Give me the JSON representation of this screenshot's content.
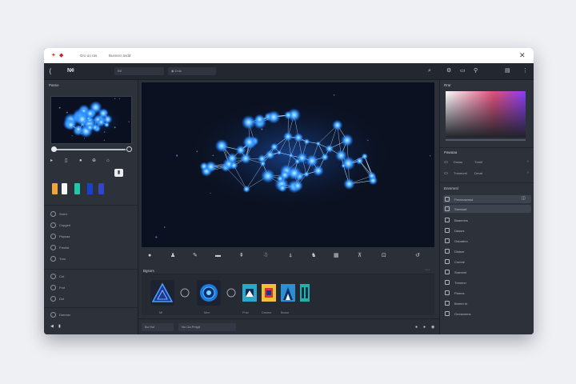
{
  "titlebar": {
    "logo_glyph": "✦",
    "logo_glyph_2": "◆",
    "title_left": "Gro oo ras",
    "title_right": "Busnxsr avdd",
    "close_label": "✕"
  },
  "toolbar": {
    "back_glyph": "⟨",
    "app_name": "N¢",
    "field_1": "BS           ",
    "field_2": "◉ Dnts",
    "icons_right": [
      "⌕",
      "⚙",
      "▭",
      "⚲",
      "▤",
      "⋮"
    ]
  },
  "left_panel": {
    "header": "Passo",
    "slider_fraction": 0.94,
    "row_icons": [
      "▸",
      "▯",
      "●",
      "⊕",
      "⌂",
      "⊙"
    ],
    "toggle_glyph": "▮",
    "swatch_colors": [
      "#f2a33a",
      "#f6f6f6",
      "#22c6a8",
      "#1b3fcf",
      "#2f46c8"
    ],
    "items": [
      {
        "label": "Snrrd"
      },
      {
        "label": "Cnpgeri"
      },
      {
        "label": "Pspcaa"
      },
      {
        "label": "Frenlst"
      },
      {
        "label": "Tnrs"
      },
      {
        "label": "Cnt"
      },
      {
        "label": "Frot"
      },
      {
        "label": "Dcf"
      }
    ],
    "bottom_item": "Dmnnsr",
    "bottom_icons": [
      "◀",
      "▮"
    ]
  },
  "canvas": {
    "description_hidden": ""
  },
  "controls": {
    "icons": [
      "●",
      "♟",
      "✎",
      "▬",
      "⇞",
      "☃",
      "⍋",
      "♞",
      "▦",
      "⊼",
      "⊡",
      "↺"
    ]
  },
  "assets": {
    "header": "Bgssrs",
    "menu_glyph": "⋯",
    "items": [
      {
        "label": "MI"
      },
      {
        "label": ""
      },
      {
        "label": "Mnn"
      },
      {
        "label": ""
      },
      {
        "label": "Pnst"
      },
      {
        "label": "Dnstno"
      },
      {
        "label": "Bcsse"
      },
      {
        "label": ""
      }
    ]
  },
  "status_bar": {
    "field_1": "Bu Hoi",
    "field_2": "Nn Oa Pmgit",
    "icons": [
      "●",
      "●",
      "◉",
      "⊙",
      "⊙",
      "◎",
      "◎",
      "⊕",
      "▯",
      "⋮"
    ]
  },
  "right_panel": {
    "header_top": "Rrar",
    "section_1": "Pawaaa",
    "row_1": {
      "a": "Dnsss",
      "b": "Tnmil"
    },
    "row_2": {
      "a": "Tnmeuml",
      "b": "Drnat"
    },
    "section_2": "Enmmrsl",
    "layers": [
      {
        "label": "Pesnnasmsd",
        "selected": true
      },
      {
        "label": "Ssessad",
        "selected": true
      },
      {
        "label": "Baanmns",
        "selected": false
      },
      {
        "label": "Dassrs",
        "selected": false
      },
      {
        "label": "Oniosilnn",
        "selected": false
      },
      {
        "label": "Dlstsm",
        "selected": false
      },
      {
        "label": "Cnmnlr",
        "selected": false
      },
      {
        "label": "Sramnnl",
        "selected": false
      },
      {
        "label": "Tnmnnn",
        "selected": false
      },
      {
        "label": "Pamos",
        "selected": false
      },
      {
        "label": "Bmmrt rlr",
        "selected": false
      },
      {
        "label": "Gmnsmnns",
        "selected": false
      }
    ]
  }
}
